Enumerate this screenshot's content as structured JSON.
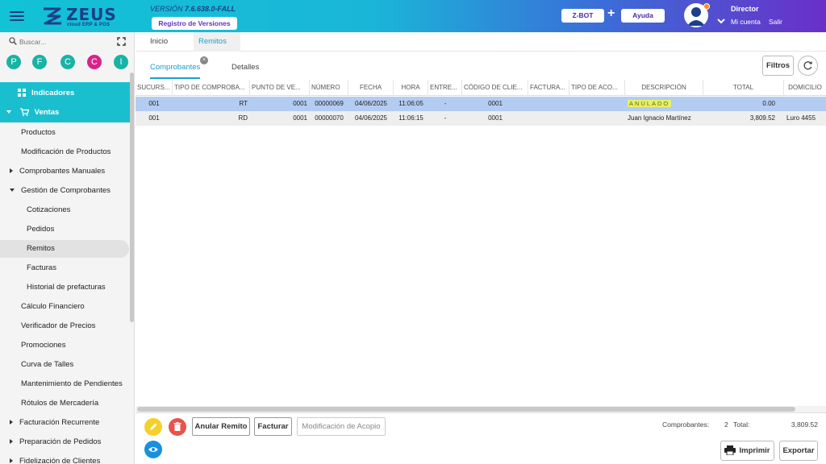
{
  "header": {
    "brand": "ZEUS",
    "brand_sub": "cloud ERP & POS",
    "version_label": "VERSIÓN",
    "version_value": "7.6.638.0-FALL",
    "registro_btn": "Registro de Versiones",
    "zbot_btn": "Z-BOT",
    "plus": "+",
    "ayuda_btn": "Ayuda",
    "user_name": "Director",
    "mi_cuenta": "Mi cuenta",
    "salir": "Salir"
  },
  "sidebar": {
    "search_placeholder": "Buscar...",
    "quick": [
      {
        "letter": "P",
        "color": "#19b3a6"
      },
      {
        "letter": "F",
        "color": "#19b3a6"
      },
      {
        "letter": "C",
        "color": "#19b3a6"
      },
      {
        "letter": "C",
        "color": "#d6248a"
      },
      {
        "letter": "I",
        "color": "#19b3a6"
      }
    ],
    "indicadores": "Indicadores",
    "ventas": "Ventas",
    "items": [
      "Productos",
      "Modificación de Productos",
      "Comprobantes Manuales",
      "Gestión de Comprobantes",
      "Cotizaciones",
      "Pedidos",
      "Remitos",
      "Facturas",
      "Historial de prefacturas",
      "Cálculo Financiero",
      "Verificador de Precios",
      "Promociones",
      "Curva de Talles",
      "Mantenimiento de Pendientes",
      "Rótulos de Mercadería",
      "Facturación Recurrente",
      "Preparación de Pedidos",
      "Fidelización de Clientes"
    ]
  },
  "tabs": {
    "inicio": "Inicio",
    "remitos": "Remitos",
    "close": "×"
  },
  "subtabs": {
    "comprobantes": "Comprobantes",
    "detalles": "Detalles"
  },
  "toolbar": {
    "filtros": "Filtros"
  },
  "grid": {
    "headers": [
      "SUCURS...",
      "TIPO DE COMPROBA...",
      "PUNTO DE VE...",
      "NÚMERO",
      "FECHA",
      "HORA",
      "ENTRE...",
      "CÓDIGO DE CLIE...",
      "FACTURA...",
      "TIPO DE ACO...",
      "DESCRIPCIÓN",
      "TOTAL",
      "DOMICILIO"
    ],
    "rows": [
      {
        "sucursal": "001",
        "tipo": "RT",
        "punto": "0001",
        "numero": "00000069",
        "fecha": "04/06/2025",
        "hora": "11:06:05",
        "entrega": "-",
        "cliente": "0001",
        "factura": "",
        "acopio": "",
        "descripcion": "ANULADO",
        "total": "0.00",
        "domicilio": ""
      },
      {
        "sucursal": "001",
        "tipo": "RD",
        "punto": "0001",
        "numero": "00000070",
        "fecha": "04/06/2025",
        "hora": "11:06:15",
        "entrega": "-",
        "cliente": "0001",
        "factura": "",
        "acopio": "",
        "descripcion": "Juan Ignacio Martínez",
        "total": "3,809.52",
        "domicilio": "Luro 4455"
      }
    ]
  },
  "footer": {
    "anular": "Anular Remito",
    "facturar": "Facturar",
    "acopio": "Modificación de Acopio",
    "comprobantes_label": "Comprobantes:",
    "comprobantes_count": "2",
    "total_label": "Total:",
    "total_value": "3,809.52",
    "imprimir": "Imprimir",
    "exportar": "Exportar"
  },
  "colors": {
    "edit": "#f5d02a",
    "delete": "#e8524a",
    "view": "#1a8fe0"
  }
}
